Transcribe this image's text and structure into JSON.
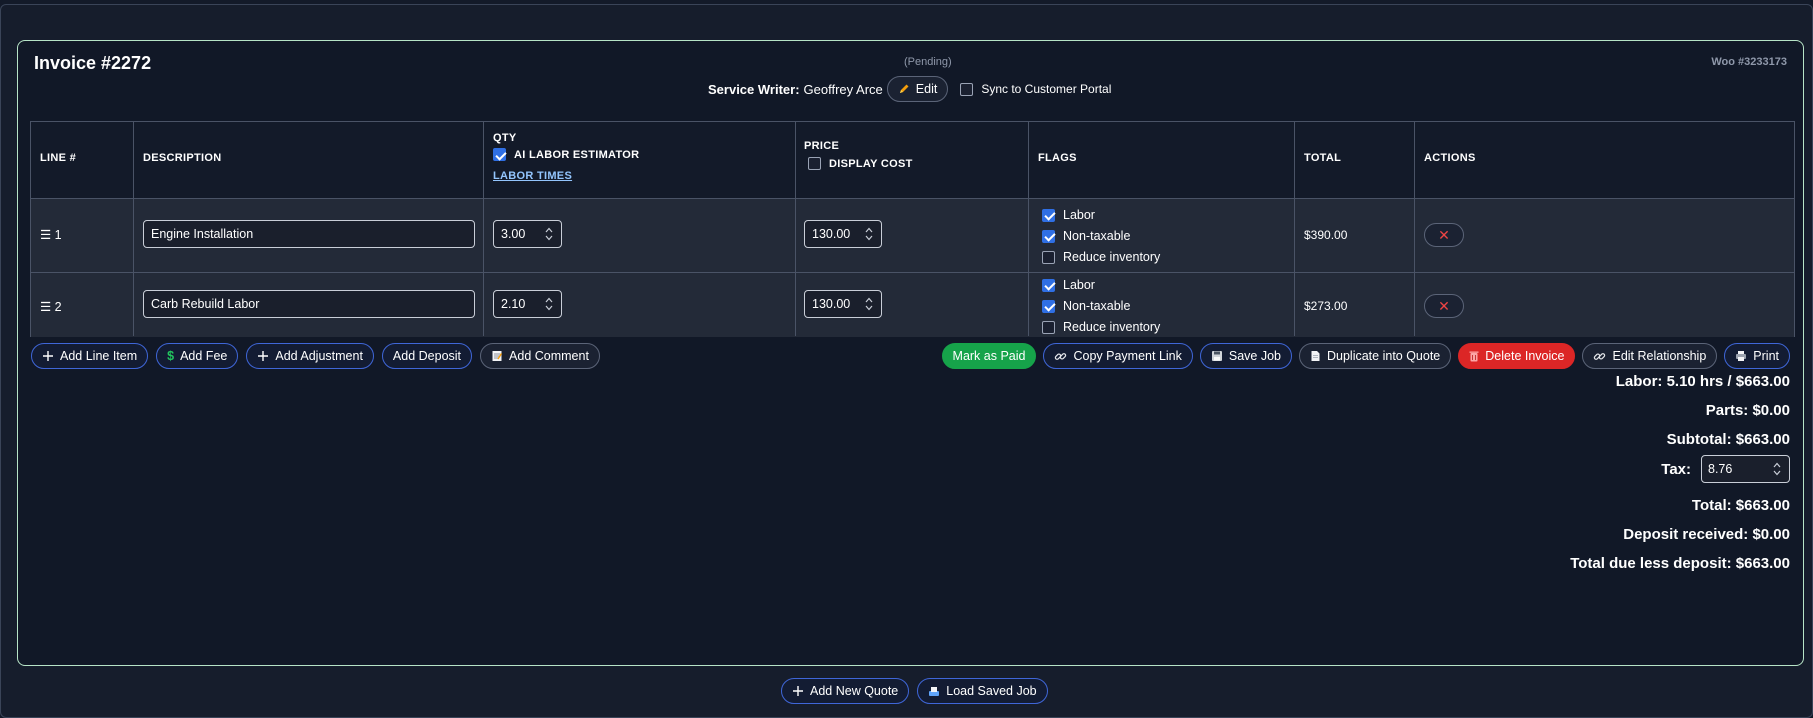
{
  "invoice": {
    "title": "Invoice #2272",
    "status": "(Pending)",
    "woo_ref": "Woo #3233173",
    "service_writer_label": "Service Writer:",
    "service_writer_name": "Geoffrey Arce",
    "edit_label": "Edit",
    "sync_label": "Sync to Customer Portal",
    "sync_checked": false
  },
  "table": {
    "headers": {
      "line": "LINE #",
      "description": "DESCRIPTION",
      "qty": "QTY",
      "ai_estimator": "AI LABOR ESTIMATOR",
      "labor_times": "LABOR TIMES",
      "price": "PRICE",
      "display_cost": "DISPLAY COST",
      "flags": "FLAGS",
      "total": "TOTAL",
      "actions": "ACTIONS"
    },
    "ai_estimator_checked": true,
    "display_cost_checked": false,
    "rows": [
      {
        "line": "☰ 1",
        "description": "Engine Installation",
        "qty": "3.00",
        "price": "130.00",
        "flag_labor": "Labor",
        "flag_nontaxable": "Non-taxable",
        "flag_reduce": "Reduce inventory",
        "labor_checked": true,
        "nontaxable_checked": true,
        "reduce_checked": false,
        "total": "$390.00",
        "delete_glyph": "✕"
      },
      {
        "line": "☰ 2",
        "description": "Carb Rebuild Labor",
        "qty": "2.10",
        "price": "130.00",
        "flag_labor": "Labor",
        "flag_nontaxable": "Non-taxable",
        "flag_reduce": "Reduce inventory",
        "labor_checked": true,
        "nontaxable_checked": true,
        "reduce_checked": false,
        "total": "$273.00",
        "delete_glyph": "✕"
      }
    ]
  },
  "toolbar_left": {
    "add_line_item": "Add Line Item",
    "add_fee": "Add Fee",
    "add_adjustment": "Add Adjustment",
    "add_deposit": "Add Deposit",
    "add_comment": "Add Comment"
  },
  "toolbar_right": {
    "mark_paid": "Mark as Paid",
    "copy_payment_link": "Copy Payment Link",
    "save_job": "Save Job",
    "duplicate_quote": "Duplicate into Quote",
    "delete_invoice": "Delete Invoice",
    "edit_relationship": "Edit Relationship",
    "print": "Print"
  },
  "summary": {
    "labor": "Labor: 5.10 hrs / $663.00",
    "parts": "Parts: $0.00",
    "subtotal": "Subtotal: $663.00",
    "tax_label": "Tax:",
    "tax_value": "8.76",
    "total": "Total: $663.00",
    "deposit": "Deposit received: $0.00",
    "due": "Total due less deposit: $663.00"
  },
  "bottom": {
    "add_quote": "Add New Quote",
    "load_saved_job": "Load Saved Job"
  },
  "icons": {
    "plus": "plus-icon",
    "dollar": "dollar-icon",
    "comment": "memo-icon",
    "link": "link-icon",
    "save": "floppy-icon",
    "duplicate": "page-icon",
    "trash": "trash-icon",
    "print": "printer-icon",
    "pencil": "pencil-icon",
    "load": "tray-icon"
  },
  "colors": {
    "accent_blue": "#3f66d8",
    "success": "#16a34a",
    "danger": "#dc2626",
    "card_border": "#b7e4c7"
  }
}
